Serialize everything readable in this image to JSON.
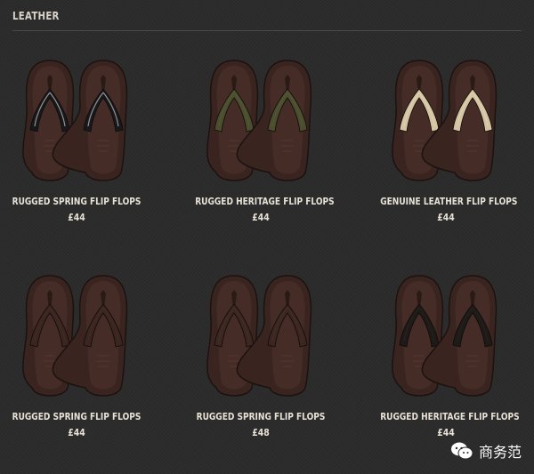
{
  "section": {
    "title": "LEATHER"
  },
  "products": [
    {
      "name": "RUGGED SPRING FLIP FLOPS",
      "price": "£44",
      "strap_color": "#17191d",
      "accent": "#e9e4dc",
      "sole": "#3a2420"
    },
    {
      "name": "RUGGED HERITAGE FLIP FLOPS",
      "price": "£44",
      "strap_color": "#4a4d2e",
      "accent": "#5c5f3b",
      "sole": "#3a2420"
    },
    {
      "name": "GENUINE LEATHER FLIP FLOPS",
      "price": "£44",
      "strap_color": "#d4c4a2",
      "accent": "#e3d6ba",
      "sole": "#3a2420"
    },
    {
      "name": "RUGGED SPRING FLIP FLOPS",
      "price": "£44",
      "strap_color": "#3a2520",
      "accent": "#4a2f28",
      "sole": "#3a2420"
    },
    {
      "name": "RUGGED SPRING FLIP FLOPS",
      "price": "£48",
      "strap_color": "#3b2621",
      "accent": "#4b322b",
      "sole": "#3a2420"
    },
    {
      "name": "RUGGED HERITAGE FLIP FLOPS",
      "price": "£44",
      "strap_color": "#1e1a18",
      "accent": "#2c2520",
      "sole": "#3a2420"
    }
  ],
  "watermark": {
    "text": "商务范",
    "icon": "wechat-icon"
  }
}
